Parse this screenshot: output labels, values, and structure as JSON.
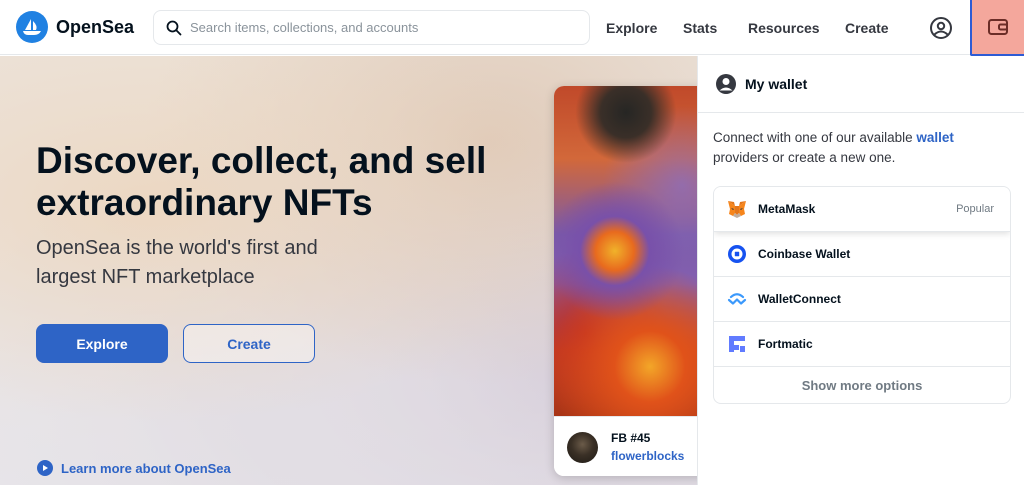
{
  "header": {
    "logo_text": "OpenSea",
    "search_placeholder": "Search items, collections, and accounts",
    "nav": [
      "Explore",
      "Stats",
      "Resources",
      "Create"
    ]
  },
  "hero": {
    "title": "Discover, collect, and sell extraordinary NFTs",
    "subtitle": "OpenSea is the world's first and largest NFT marketplace",
    "explore_label": "Explore",
    "create_label": "Create",
    "learn_more": "Learn more about OpenSea"
  },
  "nft_card": {
    "name": "FB #45",
    "collection": "flowerblocks"
  },
  "wallet": {
    "title": "My wallet",
    "desc_before": "Connect with one of our available ",
    "desc_link": "wallet",
    "desc_after": " providers or create a new one.",
    "providers": [
      {
        "name": "MetaMask",
        "badge": "Popular",
        "icon": "metamask-icon"
      },
      {
        "name": "Coinbase Wallet",
        "badge": "",
        "icon": "coinbase-icon"
      },
      {
        "name": "WalletConnect",
        "badge": "",
        "icon": "walletconnect-icon"
      },
      {
        "name": "Fortmatic",
        "badge": "",
        "icon": "fortmatic-icon"
      }
    ],
    "show_more": "Show more options"
  },
  "colors": {
    "accent": "#2e64c6",
    "wallet_button_bg": "#f4a79c",
    "brand": "#2081e2"
  }
}
